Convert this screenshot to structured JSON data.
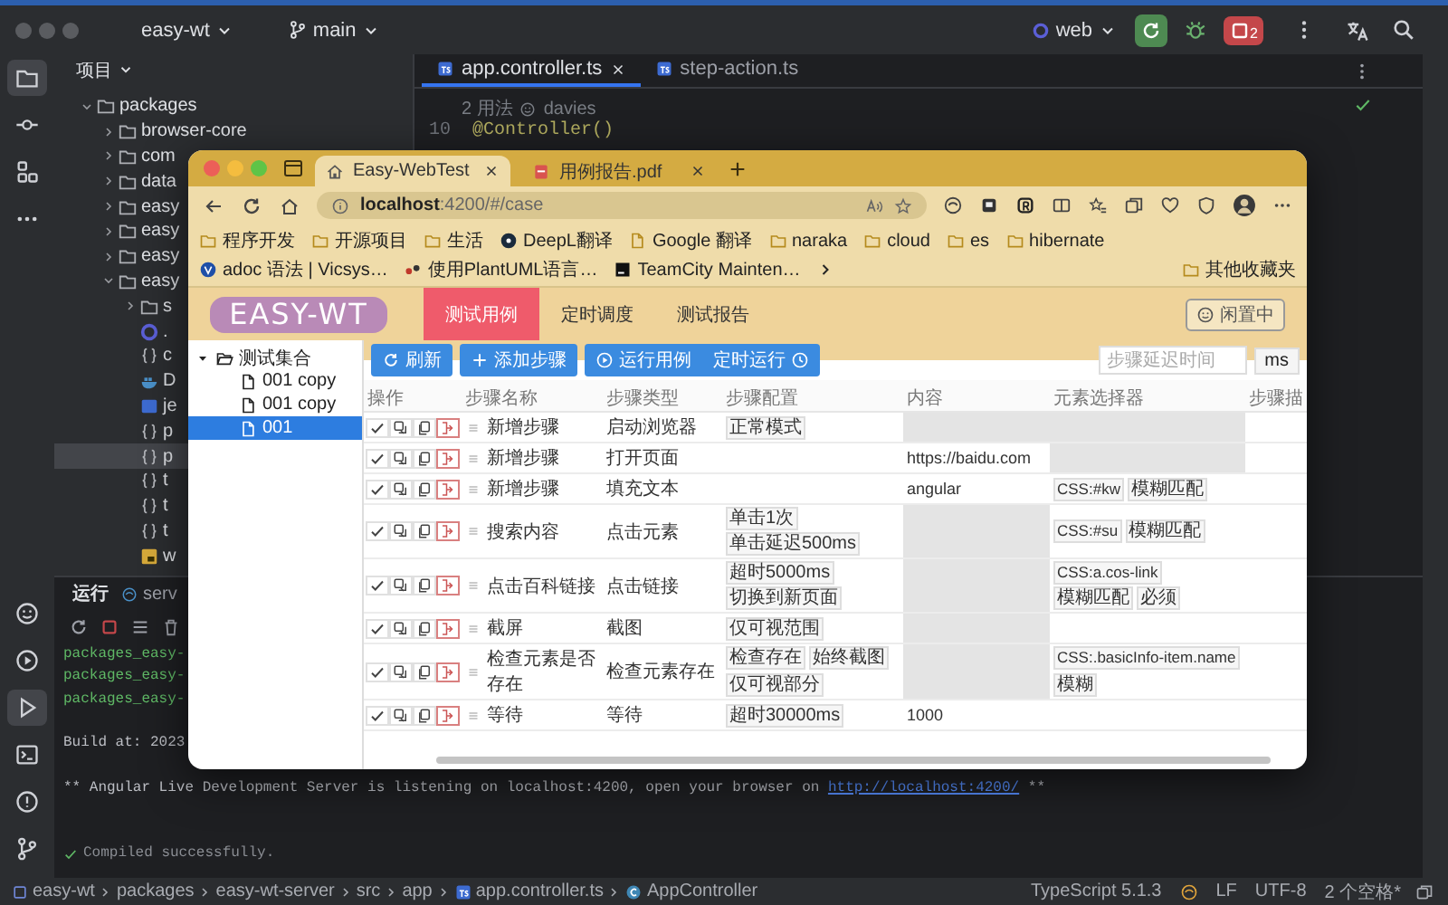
{
  "ide": {
    "title_bar": {
      "project": "easy-wt",
      "branch": "main",
      "run_config": "web",
      "stop_count": "2"
    },
    "tool_strip": {
      "top": [
        {
          "kind": "project",
          "selected": true
        },
        {
          "kind": "commit",
          "selected": false
        },
        {
          "kind": "structure",
          "selected": false
        },
        {
          "kind": "more",
          "selected": false
        }
      ],
      "bottom": [
        {
          "kind": "plugins",
          "selected": false
        },
        {
          "kind": "services",
          "selected": false
        },
        {
          "kind": "run",
          "selected": true
        },
        {
          "kind": "terminal",
          "selected": false
        },
        {
          "kind": "problems",
          "selected": false
        },
        {
          "kind": "git",
          "selected": false
        }
      ]
    },
    "project_panel": {
      "title": "项目",
      "tree": [
        {
          "label": "packages",
          "kind": "folder",
          "expanded": true,
          "selected": false,
          "children": [
            {
              "label": "browser-core",
              "kind": "folder",
              "expanded": false,
              "selected": false
            },
            {
              "label": "com",
              "kind": "folder",
              "expanded": false,
              "selected": false
            },
            {
              "label": "data",
              "kind": "folder",
              "expanded": false,
              "selected": false
            },
            {
              "label": "easy",
              "kind": "folder",
              "expanded": false,
              "selected": false
            },
            {
              "label": "easy",
              "kind": "folder",
              "expanded": false,
              "selected": false
            },
            {
              "label": "easy",
              "kind": "folder",
              "expanded": false,
              "selected": false
            },
            {
              "label": "easy",
              "kind": "folder",
              "expanded": true,
              "selected": false,
              "children": [
                {
                  "label": "s",
                  "kind": "folder",
                  "expanded": false,
                  "selected": false
                },
                {
                  "label": ".",
                  "kind": "circle",
                  "selected": false
                },
                {
                  "label": "c",
                  "kind": "braces",
                  "selected": false
                },
                {
                  "label": "D",
                  "kind": "docker",
                  "selected": false
                },
                {
                  "label": "je",
                  "kind": "json",
                  "selected": false
                },
                {
                  "label": "p",
                  "kind": "braces",
                  "selected": false
                },
                {
                  "label": "p",
                  "kind": "braces",
                  "selected": true
                },
                {
                  "label": "t",
                  "kind": "braces",
                  "selected": false
                },
                {
                  "label": "t",
                  "kind": "braces",
                  "selected": false
                },
                {
                  "label": "t",
                  "kind": "braces",
                  "selected": false
                },
                {
                  "label": "w",
                  "kind": "js",
                  "selected": false
                }
              ]
            }
          ]
        }
      ]
    },
    "editor": {
      "tabs": [
        {
          "label": "app.controller.ts",
          "selected": true
        },
        {
          "label": "step-action.ts",
          "selected": false
        }
      ],
      "usages": "2 用法",
      "author": "davies",
      "line_number": "10",
      "code": "@Controller()"
    },
    "run_panel": {
      "tabs": [
        {
          "label": "运行",
          "selected": true
        },
        {
          "label": "serv",
          "selected": false
        }
      ],
      "console": [
        {
          "kind": "success",
          "text": "packages_easy-"
        },
        {
          "kind": "success",
          "text": "packages_easy-"
        },
        {
          "kind": "success",
          "text": "packages_easy-"
        },
        {
          "kind": "plain",
          "text": "Build at: 2023"
        },
        {
          "kind": "info",
          "text": "** Angular Live Development Server is listening on localhost:4200, open your browser on",
          "link": "http://localhost:4200/",
          "tail": "**"
        },
        {
          "kind": "done",
          "text": "Compiled successfully."
        }
      ]
    },
    "status_bar": {
      "breadcrumbs": [
        {
          "kind": "project",
          "label": "easy-wt"
        },
        {
          "kind": "plain",
          "label": "packages"
        },
        {
          "kind": "plain",
          "label": "easy-wt-server"
        },
        {
          "kind": "plain",
          "label": "src"
        },
        {
          "kind": "plain",
          "label": "app"
        },
        {
          "kind": "ts",
          "label": "app.controller.ts"
        },
        {
          "kind": "class",
          "label": "AppController"
        }
      ],
      "language": "TypeScript 5.1.3",
      "line_separator": "LF",
      "encoding": "UTF-8",
      "indent": "2 个空格*"
    }
  },
  "browser": {
    "tabs": [
      {
        "kind": "site",
        "label": "Easy-WebTest",
        "selected": true
      },
      {
        "kind": "pdf",
        "label": "用例报告.pdf",
        "selected": false
      }
    ],
    "url": "**localhost**:4200/#/case",
    "bookmarks": [
      {
        "kind": "folder",
        "label": "程序开发"
      },
      {
        "kind": "folder",
        "label": "开源项目"
      },
      {
        "kind": "folder",
        "label": "生活"
      },
      {
        "kind": "deepl",
        "label": "DeepL翻译"
      },
      {
        "kind": "page",
        "label": "Google 翻译"
      },
      {
        "kind": "folder",
        "label": "naraka"
      },
      {
        "kind": "folder",
        "label": "cloud"
      },
      {
        "kind": "folder",
        "label": "es"
      },
      {
        "kind": "folder",
        "label": "hibernate"
      },
      {
        "kind": "v",
        "label": "adoc 语法 | Vicsys…"
      },
      {
        "kind": "plantuml",
        "label": "使用PlantUML语言…"
      },
      {
        "kind": "teamcity",
        "label": "TeamCity Mainten…"
      }
    ],
    "other_bookmarks": "其他收藏夹",
    "app": {
      "logo": "EASY-WT",
      "nav": [
        {
          "label": "测试用例",
          "selected": true
        },
        {
          "label": "定时调度",
          "selected": false
        },
        {
          "label": "测试报告",
          "selected": false
        }
      ],
      "status": "闲置中",
      "suites": [
        {
          "label": "测试集合",
          "expanded": true,
          "selected": false,
          "children": [
            {
              "label": "001 copy",
              "selected": false
            },
            {
              "label": "001 copy",
              "selected": false
            },
            {
              "label": "001",
              "selected": true
            }
          ]
        }
      ],
      "toolbar": [
        {
          "kind": "refresh",
          "label": "刷新"
        },
        {
          "kind": "add",
          "label": "添加步骤"
        },
        {
          "kind": "run",
          "label": "运行用例"
        },
        {
          "kind": "schedule",
          "label": "定时运行"
        }
      ],
      "delay": {
        "placeholder": "步骤延迟时间",
        "unit": "ms"
      },
      "columns": [
        "操作",
        "步骤名称",
        "步骤类型",
        "步骤配置",
        "内容",
        "元素选择器",
        "步骤描"
      ],
      "steps": [
        {
          "name": "新增步骤",
          "type": "启动浏览器",
          "config": [
            "正常模式"
          ],
          "content": {
            "disabled": true
          },
          "selector": {
            "disabled": true
          }
        },
        {
          "name": "新增步骤",
          "type": "打开页面",
          "content": {
            "text": "https://baidu.com",
            "disabled": false
          },
          "selector": {
            "disabled": true
          }
        },
        {
          "name": "新增步骤",
          "type": "填充文本",
          "content": {
            "text": "angular",
            "disabled": false
          },
          "selector": {
            "tags": [
              "CSS:#kw",
              "模糊匹配"
            ],
            "disabled": false
          }
        },
        {
          "name": "搜索内容",
          "type": "点击元素",
          "config": [
            "单击1次",
            "单击延迟500ms"
          ],
          "content": {
            "disabled": true
          },
          "selector": {
            "tags": [
              "CSS:#su",
              "模糊匹配"
            ],
            "disabled": false
          }
        },
        {
          "name": "点击百科链接",
          "type": "点击链接",
          "config": [
            "超时5000ms",
            "切换到新页面"
          ],
          "content": {
            "disabled": true
          },
          "selector": {
            "tags": [
              "CSS:a.cos-link",
              "模糊匹配",
              "必须"
            ],
            "disabled": false
          }
        },
        {
          "name": "截屏",
          "type": "截图",
          "config": [
            "仅可视范围"
          ],
          "content": {
            "disabled": true
          },
          "selector": {
            "disabled": false
          }
        },
        {
          "name": "检查元素是否存在",
          "type": "检查元素存在",
          "config": [
            "检查存在",
            "始终截图",
            "仅可视部分"
          ],
          "content": {
            "disabled": true
          },
          "selector": {
            "tags": [
              "CSS:.basicInfo-item.name",
              "模糊"
            ],
            "disabled": false
          }
        },
        {
          "name": "等待",
          "type": "等待",
          "config": [
            "超时30000ms"
          ],
          "content": {
            "text": "1000",
            "disabled": false
          },
          "selector": {
            "disabled": false
          }
        }
      ]
    }
  }
}
